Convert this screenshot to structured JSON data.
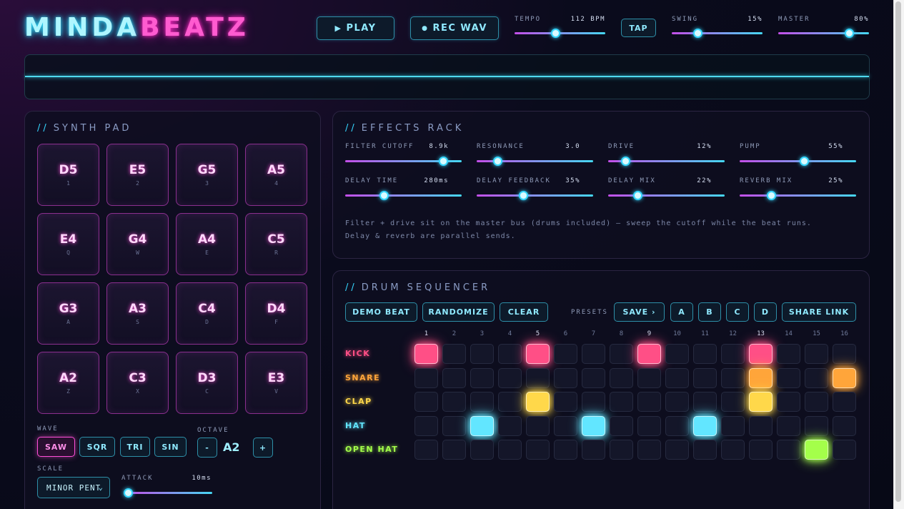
{
  "header": {
    "logo_part1": "MINDA",
    "logo_part2": "BEATZ",
    "play_label": "PLAY",
    "play_icon": "play-icon",
    "rec_label": "REC WAV",
    "rec_icon": "record-dot-icon",
    "tap_label": "TAP",
    "controls": [
      {
        "label": "TEMPO",
        "value": "112 BPM",
        "level": 0.45
      },
      {
        "label": "SWING",
        "value": "15%",
        "level": 0.28
      },
      {
        "label": "MASTER",
        "value": "80%",
        "level": 0.78
      }
    ]
  },
  "synth": {
    "title": "SYNTH PAD",
    "pads": [
      {
        "note": "D5",
        "key": "1"
      },
      {
        "note": "E5",
        "key": "2"
      },
      {
        "note": "G5",
        "key": "3"
      },
      {
        "note": "A5",
        "key": "4"
      },
      {
        "note": "E4",
        "key": "Q"
      },
      {
        "note": "G4",
        "key": "W"
      },
      {
        "note": "A4",
        "key": "E"
      },
      {
        "note": "C5",
        "key": "R"
      },
      {
        "note": "G3",
        "key": "A"
      },
      {
        "note": "A3",
        "key": "S"
      },
      {
        "note": "C4",
        "key": "D"
      },
      {
        "note": "D4",
        "key": "F"
      },
      {
        "note": "A2",
        "key": "Z"
      },
      {
        "note": "C3",
        "key": "X"
      },
      {
        "note": "D3",
        "key": "C"
      },
      {
        "note": "E3",
        "key": "V"
      }
    ],
    "wave_label": "WAVE",
    "waves": [
      "SAW",
      "SQR",
      "TRI",
      "SIN"
    ],
    "active_wave": "SAW",
    "octave_label": "OCTAVE",
    "octave_minus": "-",
    "octave_value": "A2",
    "octave_plus": "+",
    "scale_label": "SCALE",
    "scale_value": "MINOR PENT",
    "attack_label": "ATTACK",
    "attack_value": "10ms",
    "attack_level": 0.02
  },
  "effects": {
    "title": "EFFECTS RACK",
    "knobs": [
      {
        "label": "FILTER CUTOFF",
        "value": "8.9k",
        "level": 0.84
      },
      {
        "label": "RESONANCE",
        "value": "3.0",
        "level": 0.18
      },
      {
        "label": "DRIVE",
        "value": "12%",
        "level": 0.15
      },
      {
        "label": "PUMP",
        "value": "55%",
        "level": 0.55
      },
      {
        "label": "DELAY TIME",
        "value": "280ms",
        "level": 0.33
      },
      {
        "label": "DELAY FEEDBACK",
        "value": "35%",
        "level": 0.4
      },
      {
        "label": "DELAY MIX",
        "value": "22%",
        "level": 0.25
      },
      {
        "label": "REVERB MIX",
        "value": "25%",
        "level": 0.27
      }
    ],
    "note1": "Filter + drive sit on the master bus (drums included) — sweep the cutoff while the beat runs.",
    "note2": "Delay & reverb are parallel sends."
  },
  "sequencer": {
    "title": "DRUM SEQUENCER",
    "buttons": [
      "DEMO BEAT",
      "RANDOMIZE",
      "CLEAR"
    ],
    "presets_label": "PRESETS",
    "save_label": "SAVE ›",
    "preset_slots": [
      "A",
      "B",
      "C",
      "D"
    ],
    "share_label": "SHARE LINK",
    "steps": [
      "1",
      "2",
      "3",
      "4",
      "5",
      "6",
      "7",
      "8",
      "9",
      "10",
      "11",
      "12",
      "13",
      "14",
      "15",
      "16"
    ],
    "rows": [
      {
        "name": "KICK",
        "color": "#ff4f86",
        "pattern": [
          1,
          0,
          0,
          0,
          1,
          0,
          0,
          0,
          1,
          0,
          0,
          0,
          1,
          0,
          0,
          0
        ]
      },
      {
        "name": "SNARE",
        "color": "#ffa53a",
        "pattern": [
          0,
          0,
          0,
          0,
          0,
          0,
          0,
          0,
          0,
          0,
          0,
          0,
          1,
          0,
          0,
          1
        ]
      },
      {
        "name": "CLAP",
        "color": "#ffd84a",
        "pattern": [
          0,
          0,
          0,
          0,
          1,
          0,
          0,
          0,
          0,
          0,
          0,
          0,
          1,
          0,
          0,
          0
        ]
      },
      {
        "name": "HAT",
        "color": "#62e6ff",
        "pattern": [
          0,
          0,
          1,
          0,
          0,
          0,
          1,
          0,
          0,
          0,
          1,
          0,
          0,
          0,
          0,
          0
        ]
      },
      {
        "name": "OPEN HAT",
        "color": "#a4ff4a",
        "pattern": [
          0,
          0,
          0,
          0,
          0,
          0,
          0,
          0,
          0,
          0,
          0,
          0,
          0,
          0,
          1,
          0
        ]
      }
    ]
  }
}
